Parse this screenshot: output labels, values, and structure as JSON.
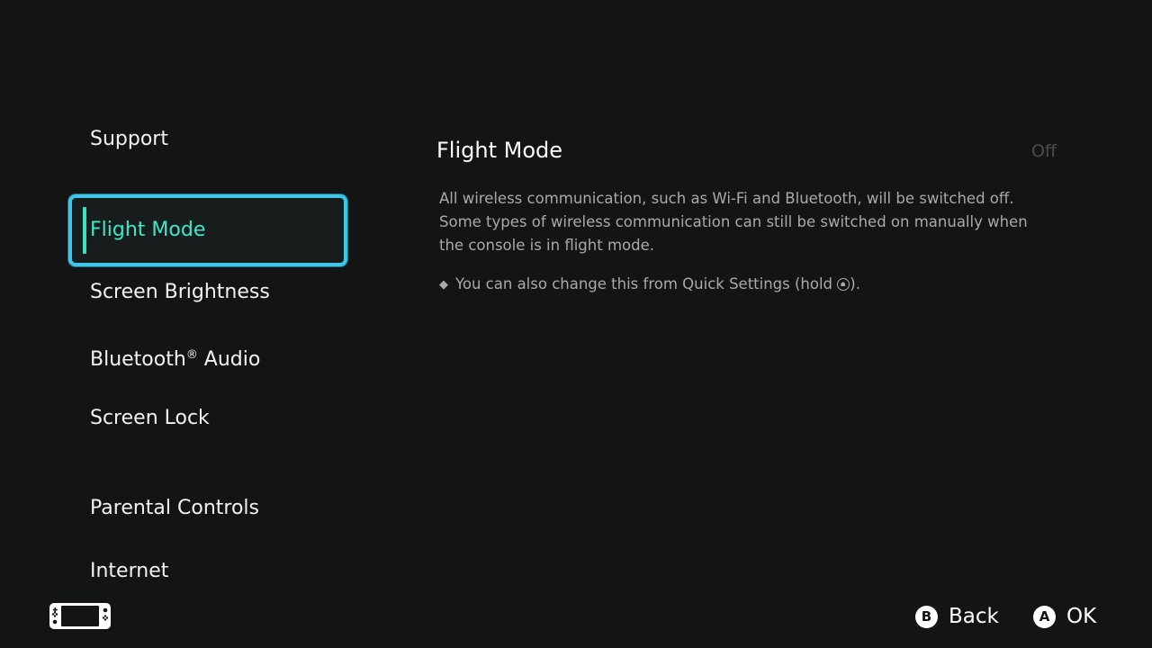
{
  "sidebar": {
    "items": [
      {
        "label": "Support"
      },
      {
        "label": "Flight Mode",
        "selected": true
      },
      {
        "label": "Screen Brightness"
      },
      {
        "label": "Bluetooth",
        "suffix": "®",
        "label_rest": " Audio"
      },
      {
        "label": "Screen Lock"
      },
      {
        "label": "Parental Controls"
      },
      {
        "label": "Internet"
      }
    ]
  },
  "content": {
    "title": "Flight Mode",
    "value": "Off",
    "description_lines": [
      "All wireless communication, such as Wi-Fi and Bluetooth, will be switched off.",
      "Some types of wireless communication can still be switched on manually when",
      "the console is in flight mode."
    ],
    "note_prefix": "You can also change this from Quick Settings (hold ",
    "note_suffix": ")."
  },
  "footer": {
    "back": {
      "button": "B",
      "label": "Back"
    },
    "ok": {
      "button": "A",
      "label": "OK"
    }
  },
  "colors": {
    "background": "#131514",
    "selection_border": "#3ec6e6",
    "selection_text": "#3fe8c9",
    "muted_text": "#a9a9a9",
    "disabled_value": "#4b4d4c"
  },
  "icons": {
    "console": "handheld-console-icon",
    "home": "home-button-icon",
    "bullet": "diamond-bullet-icon"
  }
}
